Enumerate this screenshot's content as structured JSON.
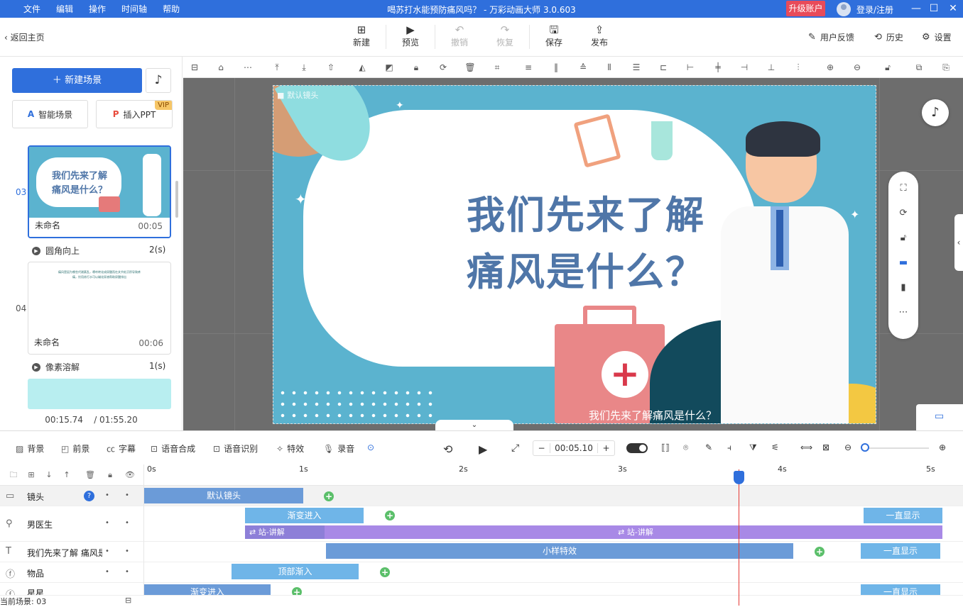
{
  "titlebar": {
    "menu": [
      "文件",
      "编辑",
      "操作",
      "时间轴",
      "帮助"
    ],
    "title": "喝苏打水能预防痛风吗？ - 万彩动画大师 3.0.603",
    "upgrade": "升级账户",
    "login": "登录/注册",
    "accent": "#2f6fdc"
  },
  "toolbar": {
    "back": "返回主页",
    "new": "新建",
    "preview": "预览",
    "undo": "撤销",
    "redo": "恢复",
    "save": "保存",
    "publish": "发布",
    "feedback": "用户反馈",
    "history": "历史",
    "settings": "设置"
  },
  "left": {
    "new_scene": "新建场景",
    "smart_scene": "智能场景",
    "insert_ppt": "插入PPT",
    "vip": "VIP",
    "scenes": [
      {
        "num": "03",
        "name": "未命名",
        "dur": "00:05",
        "thumb_line1": "我们先来了解",
        "thumb_line2": "痛风是什么？"
      },
      {
        "num": "04",
        "name": "未命名",
        "dur": "00:06",
        "thumb_text": "痛风是因为哪些代谢紊乱，嘌呤转化成尿酸而在关节处沉积导致疼痛，饮用苏打水可以碱化尿液帮助尿酸排出"
      }
    ],
    "transitions": [
      {
        "name": "圆角向上",
        "dur": "2(s)"
      },
      {
        "name": "像素溶解",
        "dur": "1(s)"
      }
    ],
    "current_time": "00:15.74",
    "total_time": "/ 01:55.20"
  },
  "stage": {
    "camera_label": "默认镜头",
    "heading_line1": "我们先来了解",
    "heading_line2": "痛风是什么？",
    "subtitle": "我们先来了解痛风是什么？"
  },
  "timeline_toolbar": {
    "background": "背景",
    "foreground": "前景",
    "captions": "字幕",
    "tts": "语音合成",
    "asr": "语音识别",
    "effects": "特效",
    "record": "录音",
    "time": "00:05.10",
    "minus": "−",
    "plus": "+"
  },
  "ruler": [
    "0s",
    "1s",
    "2s",
    "3s",
    "4s",
    "5s"
  ],
  "tracks": [
    {
      "name": "镜头",
      "clips": [
        "默认镜头"
      ]
    },
    {
      "name": "男医生",
      "clips": [
        "渐变进入",
        "一直显示",
        "站-讲解",
        "站-讲解"
      ]
    },
    {
      "name": "我们先来了解 痛风是",
      "clips": [
        "小样特效",
        "一直显示"
      ]
    },
    {
      "name": "物品",
      "clips": [
        "顶部渐入"
      ]
    },
    {
      "name": "星星",
      "clips": [
        "渐变进入",
        "一直显示"
      ]
    }
  ],
  "status": "当前场景: 03",
  "playhead_seconds": 3.72
}
